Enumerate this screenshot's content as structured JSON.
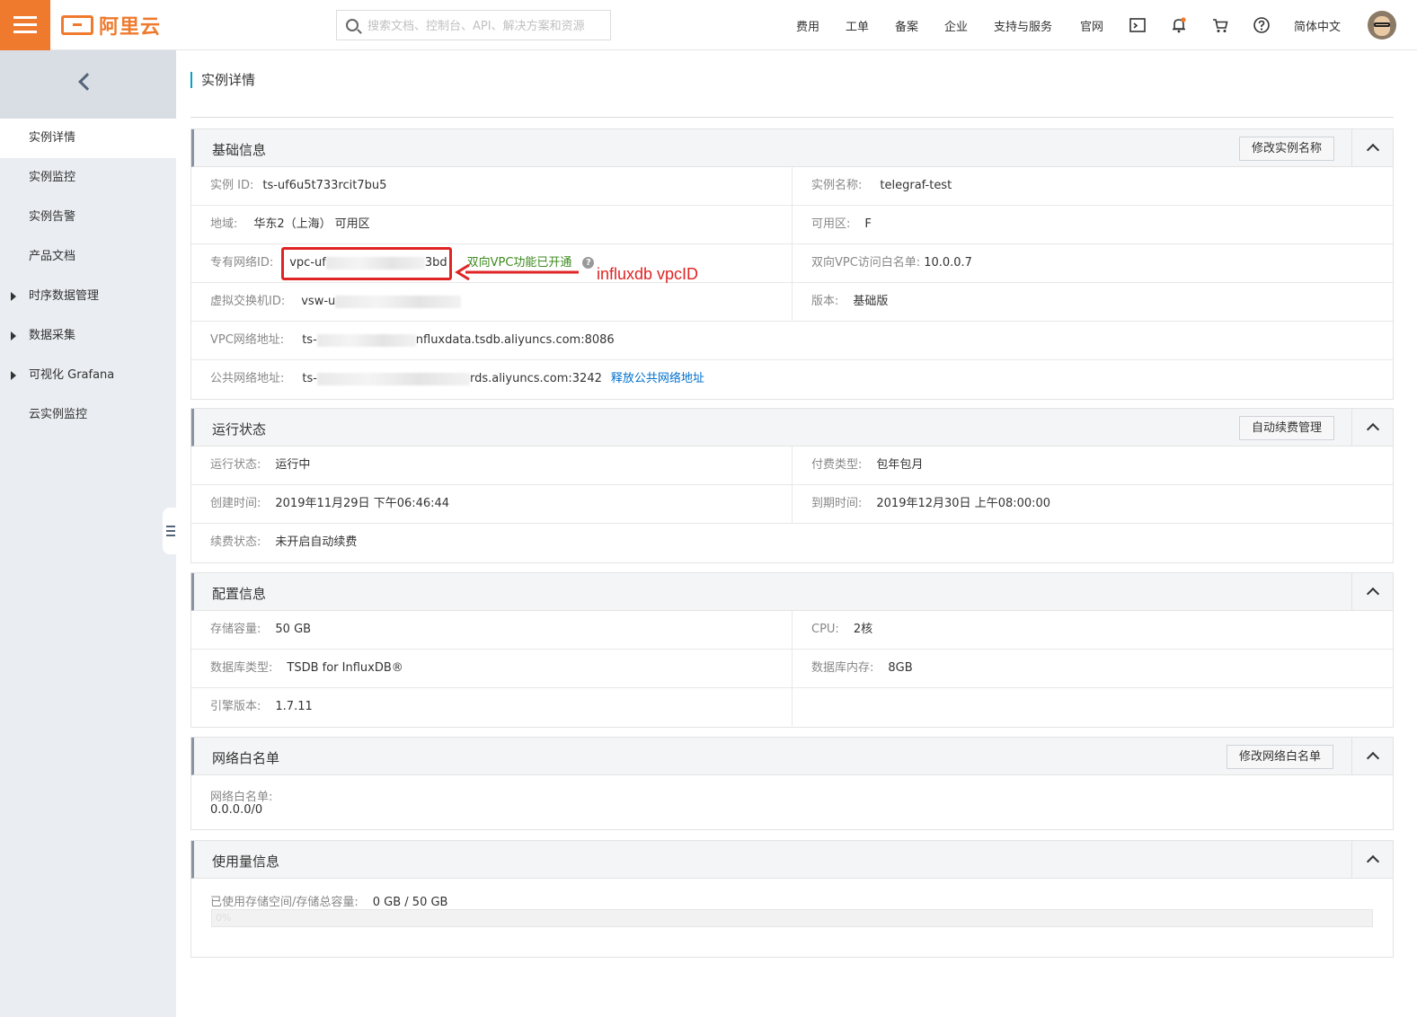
{
  "header": {
    "logo_text": "阿里云",
    "search_placeholder": "搜索文档、控制台、API、解决方案和资源",
    "nav": [
      "费用",
      "工单",
      "备案",
      "企业",
      "支持与服务",
      "官网"
    ],
    "language": "简体中文"
  },
  "sidebar": {
    "items": [
      {
        "label": "实例详情"
      },
      {
        "label": "实例监控"
      },
      {
        "label": "实例告警"
      },
      {
        "label": "产品文档"
      },
      {
        "label": "时序数据管理"
      },
      {
        "label": "数据采集"
      },
      {
        "label": "可视化 Grafana"
      },
      {
        "label": "云实例监控"
      }
    ]
  },
  "page_title": "实例详情",
  "basic": {
    "title": "基础信息",
    "button": "修改实例名称",
    "instance_id_label": "实例 ID:",
    "instance_id": "ts-uf6u5t733rcit7bu5",
    "instance_name_label": "实例名称:",
    "instance_name": "telegraf-test",
    "region_label": "地域:",
    "region": "华东2（上海）",
    "zone_suffix": "可用区",
    "zone_label": "可用区:",
    "zone": "F",
    "vpc_label": "专有网络ID:",
    "vpc_prefix": "vpc-uf",
    "vpc_suffix": "3bd",
    "vpc_status": "双向VPC功能已开通",
    "vpc_whitelist_label": "双向VPC访问白名单:",
    "vpc_whitelist": "10.0.0.7",
    "vswitch_label": "虚拟交换机ID:",
    "vswitch_prefix": "vsw-u",
    "version_label": "版本:",
    "version": "基础版",
    "vpc_addr_label": "VPC网络地址:",
    "vpc_addr_prefix": "ts-",
    "vpc_addr_suffix": "nfluxdata.tsdb.aliyuncs.com:8086",
    "public_addr_label": "公共网络地址:",
    "public_addr_prefix": "ts-",
    "public_addr_suffix": "rds.aliyuncs.com:3242",
    "public_addr_link": "释放公共网络地址"
  },
  "annotation": "influxdb vpcID",
  "runtime": {
    "title": "运行状态",
    "button": "自动续费管理",
    "status_label": "运行状态:",
    "status": "运行中",
    "pay_label": "付费类型:",
    "pay": "包年包月",
    "created_label": "创建时间:",
    "created": "2019年11月29日 下午06:46:44",
    "expire_label": "到期时间:",
    "expire": "2019年12月30日 上午08:00:00",
    "renew_label": "续费状态:",
    "renew": "未开启自动续费"
  },
  "config": {
    "title": "配置信息",
    "storage_label": "存储容量:",
    "storage": "50 GB",
    "cpu_label": "CPU:",
    "cpu": "2核",
    "dbtype_label": "数据库类型:",
    "dbtype": "TSDB for InfluxDB®",
    "mem_label": "数据库内存:",
    "mem": "8GB",
    "engine_label": "引擎版本:",
    "engine": "1.7.11"
  },
  "whitelist": {
    "title": "网络白名单",
    "button": "修改网络白名单",
    "label": "网络白名单:",
    "value": "0.0.0.0/0"
  },
  "usage": {
    "title": "使用量信息",
    "label": "已使用存储空间/存储总容量:",
    "value": "0 GB / 50 GB",
    "percent_text": "0%",
    "percent": 0
  },
  "colors": {
    "brand": "#ef7a2e",
    "annotation": "#e02424",
    "link": "#0070cc",
    "status_green": "#3c8a1e"
  }
}
